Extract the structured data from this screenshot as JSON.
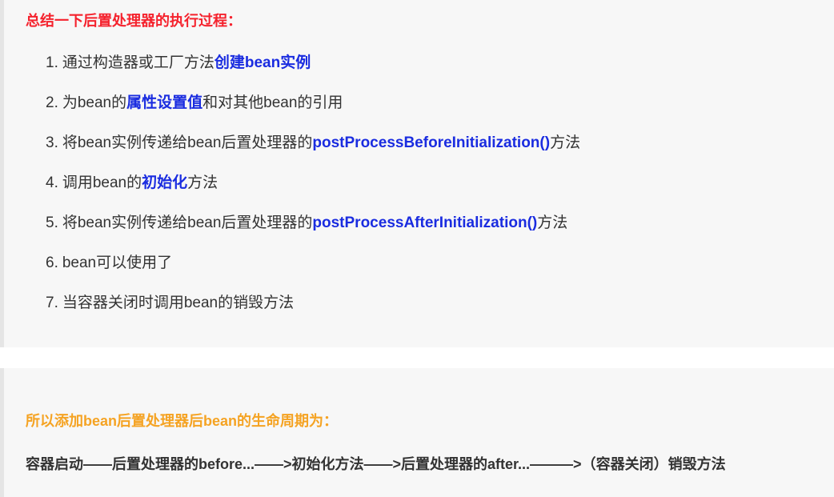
{
  "section1": {
    "heading": "总结一下后置处理器的执行过程：",
    "steps": [
      {
        "num": "1.",
        "pre": "通过构造器或工厂方法",
        "hl": "创建bean实例",
        "post": ""
      },
      {
        "num": "2.",
        "pre": "为bean的",
        "hl": "属性设置值",
        "post": "和对其他bean的引用"
      },
      {
        "num": "3.",
        "pre": "将bean实例传递给bean后置处理器的",
        "hl": "postProcessBeforeInitialization()",
        "post": "方法"
      },
      {
        "num": "4.",
        "pre": "调用bean的",
        "hl": "初始化",
        "post": "方法"
      },
      {
        "num": "5.",
        "pre": "将bean实例传递给bean后置处理器的",
        "hl": "postProcessAfterInitialization()",
        "post": "方法"
      },
      {
        "num": "6.",
        "pre": "bean可以使用了",
        "hl": "",
        "post": ""
      },
      {
        "num": "7.",
        "pre": "当容器关闭时调用bean的销毁方法",
        "hl": "",
        "post": ""
      }
    ]
  },
  "section2": {
    "heading": "所以添加bean后置处理器后bean的生命周期为：",
    "lifecycle": "容器启动——后置处理器的before...——>初始化方法——>后置处理器的after...———>（容器关闭）销毁方法"
  },
  "colors": {
    "heading_red": "#f5222d",
    "highlight_blue": "#1a2ce0",
    "heading_orange": "#f5a323",
    "body_text": "#333333",
    "block_bg": "#f7f7f7",
    "block_border": "#e5e5e5"
  }
}
